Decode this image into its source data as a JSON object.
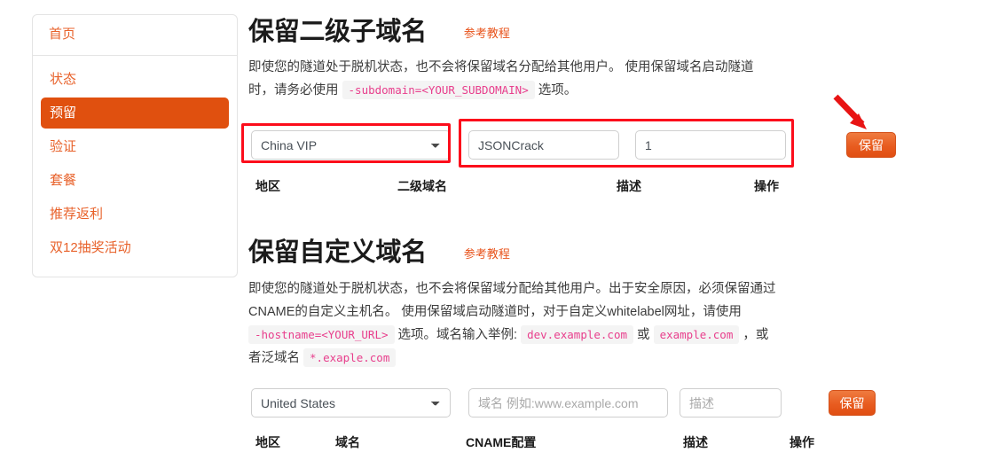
{
  "sidebar": {
    "home": {
      "label": "首页"
    },
    "items": [
      {
        "label": "状态",
        "active": false
      },
      {
        "label": "预留",
        "active": true
      },
      {
        "label": "验证",
        "active": false
      },
      {
        "label": "套餐",
        "active": false
      },
      {
        "label": "推荐返利",
        "active": false
      },
      {
        "label": "双12抽奖活动",
        "active": false
      }
    ]
  },
  "section_subdomain": {
    "title": "保留二级子域名",
    "tutorial_link": "参考教程",
    "desc_part1": "即使您的隧道处于脱机状态，也不会将保留域名分配给其他用户。 使用保留域名启动隧道时，请务必使用",
    "desc_code": "-subdomain=<YOUR_SUBDOMAIN>",
    "desc_part2": "选项。",
    "form": {
      "region_value": "China VIP",
      "subdomain_value": "JSONCrack",
      "description_value": "1",
      "reserve_button": "保留"
    },
    "table_headers": [
      "地区",
      "二级域名",
      "描述",
      "操作"
    ]
  },
  "section_custom": {
    "title": "保留自定义域名",
    "tutorial_link": "参考教程",
    "desc_part1": "即使您的隧道处于脱机状态，也不会将保留域分配给其他用户。出于安全原因，必须保留通过CNAME的自定义主机名。 使用保留域启动隧道时，对于自定义whitelabel网址，请使用",
    "desc_code1": "-hostname=<YOUR_URL>",
    "desc_part2": "选项。域名输入举例:",
    "desc_code2": "dev.example.com",
    "desc_part3": "或",
    "desc_code3": "example.com",
    "desc_part4": "，或者泛域名",
    "desc_code4": "*.exaple.com",
    "form": {
      "region_value": "United States",
      "domain_placeholder": "域名 例如:www.example.com",
      "description_placeholder": "描述",
      "reserve_button": "保留"
    },
    "table_headers": [
      "地区",
      "域名",
      "CNAME配置",
      "描述",
      "操作"
    ]
  },
  "annotations": {
    "highlight_color": "#fc0d1b",
    "arrow_color": "#e81414"
  },
  "colors": {
    "accent": "#e8622b",
    "active_nav": "#e0500f",
    "button": "#e85c20",
    "code_text": "#e83e8c"
  }
}
